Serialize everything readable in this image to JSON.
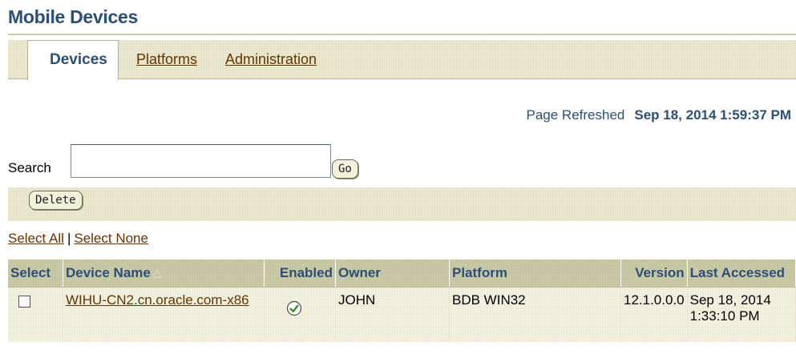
{
  "page": {
    "title": "Mobile Devices"
  },
  "tabs": [
    {
      "label": "Devices",
      "active": true
    },
    {
      "label": "Platforms",
      "active": false
    },
    {
      "label": "Administration",
      "active": false
    }
  ],
  "refresh": {
    "label": "Page Refreshed",
    "value": "Sep 18, 2014 1:59:37 PM"
  },
  "search": {
    "label": "Search",
    "value": "",
    "go_label": "Go"
  },
  "toolbar": {
    "delete_label": "Delete"
  },
  "selection": {
    "select_all": "Select All",
    "separator": "|",
    "select_none": "Select None"
  },
  "table": {
    "columns": [
      "Select",
      "Device Name",
      "Enabled",
      "Owner",
      "Platform",
      "Version",
      "Last Accessed"
    ],
    "sort_icon": "sort-ascending-icon",
    "rows": [
      {
        "selected": false,
        "device_name": "WIHU-CN2.cn.oracle.com-x86",
        "enabled": true,
        "enabled_icon": "check-circle-icon",
        "owner": "JOHN",
        "platform": "BDB WIN32",
        "version": "12.1.0.0.0",
        "last_accessed_date": "Sep 18, 2014",
        "last_accessed_time": "1:33:10 PM"
      }
    ]
  },
  "colors": {
    "title": "#2b4f76",
    "link": "#663300",
    "tab_bar": "#ecebd2",
    "header_bg": "#ccccaa",
    "enabled_check": "#2e8b2e"
  }
}
